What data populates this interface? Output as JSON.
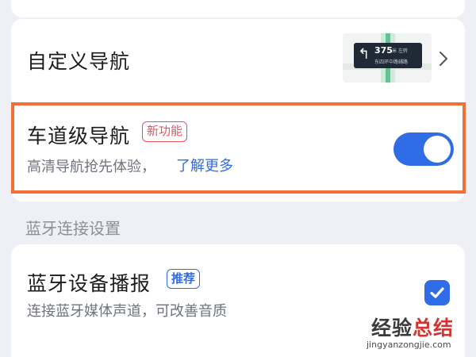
{
  "nav_settings": {
    "custom_nav": {
      "title": "自定义导航",
      "preview": {
        "distance": "375",
        "distance_unit": "米 左转",
        "street": "东四环中路辅路",
        "arrow_icon": "turn-left-arrow-icon"
      },
      "chevron_icon": "chevron-right-icon"
    },
    "lane_nav": {
      "title": "车道级导航",
      "badge": "新功能",
      "subtitle": "高清导航抢先体验，",
      "link": "了解更多",
      "toggle_on": true
    }
  },
  "bluetooth": {
    "section_label": "蓝牙连接设置",
    "broadcast": {
      "title": "蓝牙设备播报",
      "badge": "推荐",
      "subtitle": "连接蓝牙媒体声道，可改善音质",
      "checked": true
    }
  },
  "watermark": {
    "part1": "经验",
    "part2": "总结",
    "url": "jingyanzongjie.com"
  },
  "colors": {
    "accent": "#2f6ce5",
    "highlight_border": "#f07036",
    "new_badge": "#e9515a",
    "background": "#eef0f5"
  }
}
